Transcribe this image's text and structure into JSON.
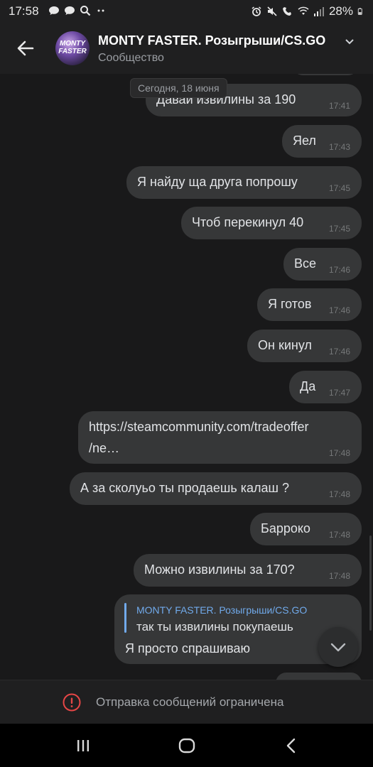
{
  "status_bar": {
    "time": "17:58",
    "left_icons": [
      "chat-bubble-icon",
      "chat-bubble-icon",
      "search-icon",
      "more-dots-icon"
    ],
    "battery": "28%"
  },
  "header": {
    "title": "MONTY FASTER. Розыгрыши/CS.GO",
    "subtitle": "Сообщество",
    "avatar_text": "MONTY FASTER"
  },
  "chat": {
    "date_label": "Сегодня, 18 июня",
    "messages": [
      {
        "text": "Давай извилины за 190",
        "time": "17:41"
      },
      {
        "text": "Яел",
        "time": "17:43"
      },
      {
        "text": "Я найду ща друга попрошу",
        "time": "17:45"
      },
      {
        "text": "Чтоб перекинул 40",
        "time": "17:45"
      },
      {
        "text": "Все",
        "time": "17:46"
      },
      {
        "text": "Я готов",
        "time": "17:46"
      },
      {
        "text": "Он кинул",
        "time": "17:46"
      },
      {
        "text": "Да",
        "time": "17:47"
      },
      {
        "link_line1": "https://steamcommunity.com/tradeoffer",
        "link_line2": "/ne…",
        "time": "17:48"
      },
      {
        "text": "А за сколуьо ты продаешь калаш ?",
        "time": "17:48"
      },
      {
        "text": "Барроко",
        "time": "17:48"
      },
      {
        "text": "Можно извилины за 170?",
        "time": "17:48"
      },
      {
        "reply_author": "MONTY FASTER. Розыгрыши/CS.GO",
        "reply_text": "так ты извилины покупаешь",
        "text": "Я просто спрашиваю"
      }
    ]
  },
  "restriction": {
    "text": "Отправка сообщений ограничена",
    "accent": "#e64646"
  },
  "colors": {
    "background": "#19191a",
    "bubble": "#363738",
    "link": "#71aaeb"
  }
}
